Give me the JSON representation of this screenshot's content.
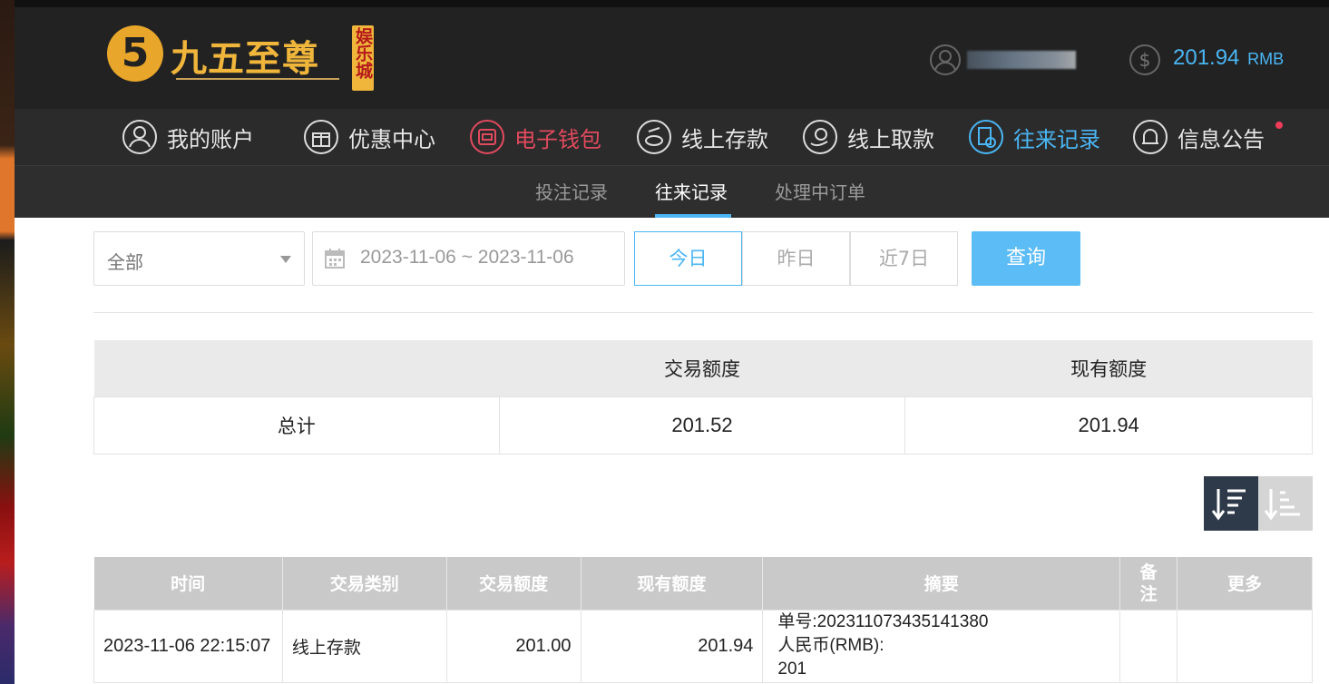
{
  "header": {
    "logo_mark": "5",
    "logo_name": "九五至尊",
    "logo_tag": "娱乐城",
    "balance_value": "201.94",
    "balance_unit": "RMB"
  },
  "nav": {
    "items": [
      {
        "label": "我的账户",
        "icon": "user-icon"
      },
      {
        "label": "优惠中心",
        "icon": "gift-icon"
      },
      {
        "label": "电子钱包",
        "icon": "wallet-icon"
      },
      {
        "label": "线上存款",
        "icon": "deposit-icon"
      },
      {
        "label": "线上取款",
        "icon": "withdraw-icon"
      },
      {
        "label": "往来记录",
        "icon": "record-icon"
      },
      {
        "label": "信息公告",
        "icon": "bell-icon"
      }
    ]
  },
  "subnav": {
    "items": [
      "投注记录",
      "往来记录",
      "处理中订单"
    ],
    "active": "往来记录"
  },
  "filters": {
    "type_selected": "全部",
    "date_range": "2023-11-06 ~ 2023-11-06",
    "quick": [
      "今日",
      "昨日",
      "近7日"
    ],
    "query_label": "查询"
  },
  "summary": {
    "headers": [
      "",
      "交易额度",
      "现有额度"
    ],
    "row_label": "总计",
    "trade_amount": "201.52",
    "current_amount": "201.94"
  },
  "records": {
    "headers": [
      "时间",
      "交易类别",
      "交易额度",
      "现有额度",
      "摘要",
      "备注",
      "更多"
    ],
    "rows": [
      {
        "time": "2023-11-06 22:15:07",
        "type": "线上存款",
        "amount": "201.00",
        "balance": "201.94",
        "summary_line1": "单号:202311073435141380",
        "summary_line2": "人民币(RMB):",
        "summary_line3": "201",
        "note": "",
        "more": ""
      }
    ]
  },
  "colors": {
    "accent": "#4ab6f4",
    "nav_active_red": "#e24a5e",
    "topbar": "#222222"
  }
}
